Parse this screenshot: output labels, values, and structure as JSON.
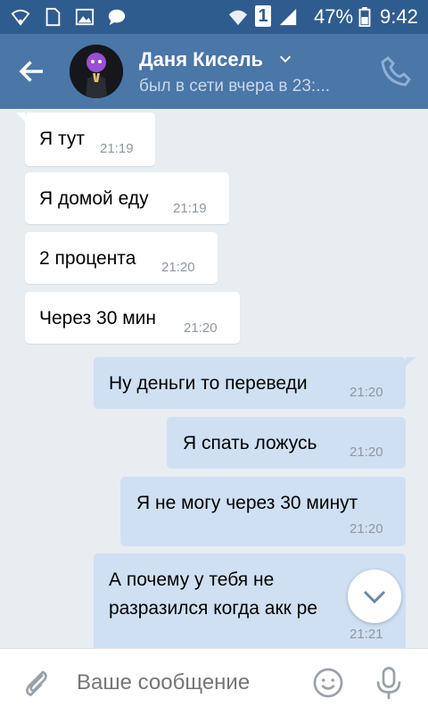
{
  "statusbar": {
    "sim_number": "1",
    "battery": "47%",
    "time": "9:42"
  },
  "header": {
    "name": "Даня Кисель",
    "status": "был в сети вчера в 23:..."
  },
  "messages": [
    {
      "text": "Я тут",
      "time": "21:19",
      "direction": "in"
    },
    {
      "text": "Я домой еду",
      "time": "21:19",
      "direction": "in"
    },
    {
      "text": "2 процента",
      "time": "21:20",
      "direction": "in"
    },
    {
      "text": "Через 30 мин",
      "time": "21:20",
      "direction": "in"
    },
    {
      "text": "Ну деньги то переведи",
      "time": "21:20",
      "direction": "out"
    },
    {
      "text": "Я спать ложусь",
      "time": "21:20",
      "direction": "out"
    },
    {
      "text": "Я не могу через 30 минут",
      "time": "21:20",
      "direction": "out"
    },
    {
      "text": "А почему у тебя не",
      "text2": "разразился когда акк ре",
      "time": "21:21",
      "direction": "out"
    }
  ],
  "composer": {
    "placeholder": "Ваше сообщение"
  },
  "colors": {
    "header": "#4a76a8",
    "statusbar": "#2f5c8e",
    "incoming": "#ffffff",
    "outgoing": "#cfe0f3",
    "background": "#e8edf2"
  },
  "icons": [
    "wifi-icon",
    "file-icon",
    "image-icon",
    "chat-bubble-icon",
    "signal-icon",
    "battery-icon",
    "back-arrow-icon",
    "chevron-down-icon",
    "phone-icon",
    "attach-icon",
    "emoji-icon",
    "mic-icon",
    "scroll-down-icon"
  ]
}
